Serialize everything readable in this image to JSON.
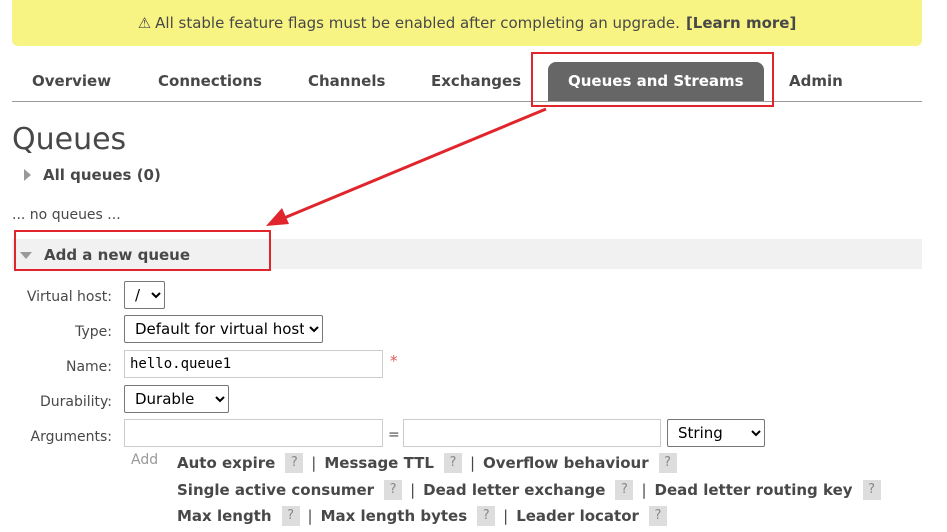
{
  "banner": {
    "icon": "warning-icon",
    "text": "All stable feature flags must be enabled after completing an upgrade.",
    "link": "[Learn more]"
  },
  "nav": {
    "tabs": [
      {
        "label": "Overview"
      },
      {
        "label": "Connections"
      },
      {
        "label": "Channels"
      },
      {
        "label": "Exchanges"
      },
      {
        "label": "Queues and Streams",
        "active": true
      },
      {
        "label": "Admin"
      }
    ]
  },
  "page": {
    "title": "Queues",
    "all_queues": "All queues (0)",
    "no_queues": "... no queues ...",
    "add_new": "Add a new queue"
  },
  "form": {
    "virtual_host": {
      "label": "Virtual host:",
      "value": "/"
    },
    "type": {
      "label": "Type:",
      "value": "Default for virtual host"
    },
    "name": {
      "label": "Name:",
      "value": "hello.queue1",
      "required_mark": "*"
    },
    "durability": {
      "label": "Durability:",
      "value": "Durable"
    },
    "arguments": {
      "label": "Arguments:",
      "key": "",
      "equals": "=",
      "value": "",
      "type": "String",
      "add": "Add"
    }
  },
  "argument_helpers": {
    "rows": [
      [
        "Auto expire",
        "Message TTL",
        "Overflow behaviour"
      ],
      [
        "Single active consumer",
        "Dead letter exchange",
        "Dead letter routing key"
      ],
      [
        "Max length",
        "Max length bytes",
        "Leader locator"
      ]
    ],
    "help": "?",
    "separator": "|"
  },
  "annotation": {
    "color": "#e0262c"
  }
}
